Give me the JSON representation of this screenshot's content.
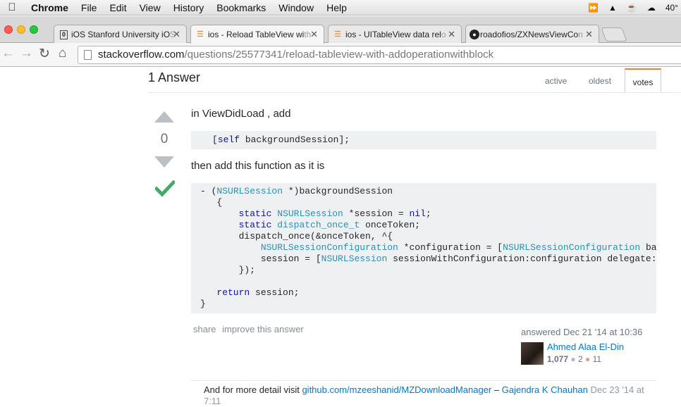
{
  "menubar": {
    "app": "Chrome",
    "items": [
      "File",
      "Edit",
      "View",
      "History",
      "Bookmarks",
      "Window",
      "Help"
    ],
    "temperature": "40°"
  },
  "tabs": [
    {
      "label": "iOS Stanford University iO",
      "fade": "S",
      "icon": "file-icon"
    },
    {
      "label": "ios - Reload TableView wi",
      "fade": "th",
      "icon": "stackoverflow-icon"
    },
    {
      "label": "ios - UITableView data rel",
      "fade": "o",
      "icon": "stackoverflow-icon"
    },
    {
      "label": "roadofios/ZXNewsViewCo",
      "fade": "n",
      "icon": "github-icon"
    }
  ],
  "url": {
    "host": "stackoverflow.com",
    "path": "/questions/25577341/reload-tableview-with-addoperationwithblock"
  },
  "answers": {
    "title": "1 Answer",
    "sort_tabs": [
      "active",
      "oldest",
      "votes"
    ]
  },
  "answer": {
    "vote_count": "0",
    "intro": "in ViewDidLoad , add",
    "code1": "[self backgroundSession];",
    "middle": "then add this function as it is",
    "post_menu": [
      "share",
      "improve this answer"
    ],
    "answered": "answered Dec 21 '14 at 10:36",
    "user": "Ahmed Alaa El-Din",
    "reputation": "1,077",
    "silver": "2",
    "bronze": "11"
  },
  "comment": {
    "text": "And for more detail visit ",
    "link": "github.com/mzeeshanid/MZDownloadManager",
    "dash": " – ",
    "user": "Gajendra K Chauhan",
    "date": "Dec 23 '14 at 7:11"
  },
  "colors": {
    "link": "#0077cc",
    "accepted": "#48a868",
    "sort_active": "#f48024"
  }
}
